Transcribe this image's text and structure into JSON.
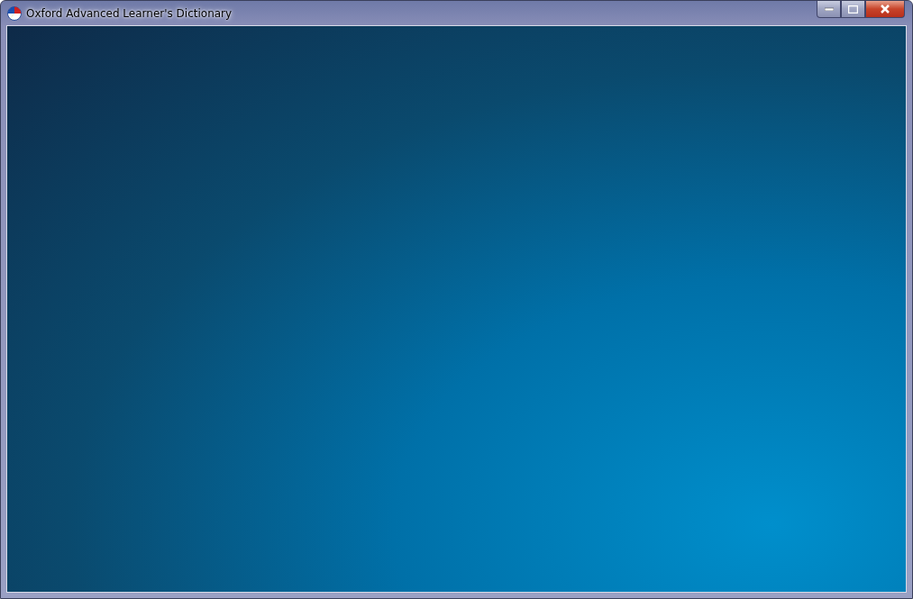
{
  "window": {
    "title": "Oxford Advanced Learner's Dictionary"
  }
}
